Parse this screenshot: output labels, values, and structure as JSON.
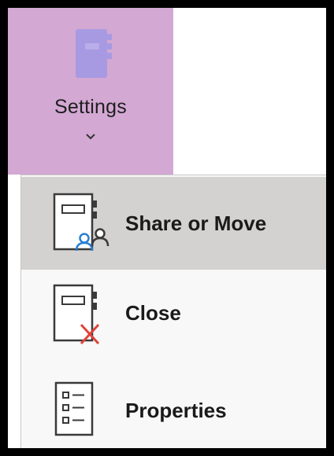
{
  "settings": {
    "label": "Settings",
    "icon": "notebook-settings-icon",
    "colors": {
      "background": "#d3a8d3",
      "icon_fill": "#a79ae2"
    }
  },
  "menu": {
    "items": [
      {
        "label": "Share or Move",
        "icon": "notebook-share-icon",
        "highlighted": true
      },
      {
        "label": "Close",
        "icon": "notebook-close-icon",
        "highlighted": false
      },
      {
        "label": "Properties",
        "icon": "properties-list-icon",
        "highlighted": false
      }
    ],
    "colors": {
      "highlight": "#d4d2d0",
      "close_x": "#e0433a",
      "person_blue": "#2a7fd4"
    }
  }
}
